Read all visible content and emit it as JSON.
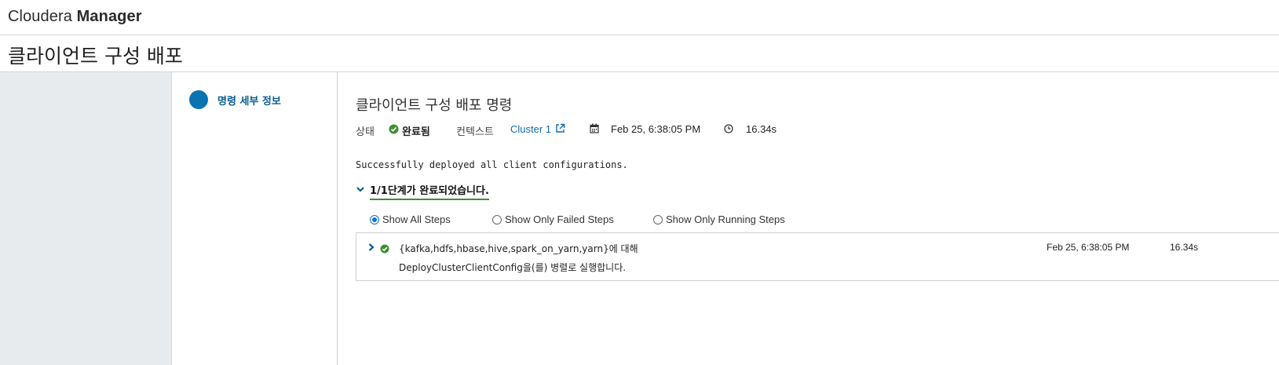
{
  "header": {
    "brand_light": "Cloudera",
    "brand_bold": "Manager"
  },
  "page": {
    "title": "클라이언트 구성 배포"
  },
  "sidebar": {
    "step_label": "명령 세부 정보"
  },
  "command": {
    "title": "클라이언트 구성 배포 명령",
    "status_label": "상태",
    "status_value": "완료됨",
    "context_label": "컨텍스트",
    "context_link": "Cluster 1",
    "start_time": "Feb 25, 6:38:05 PM",
    "duration": "16.34s",
    "message": "Successfully deployed all client configurations.",
    "summary": "1/1단계가 완료되었습니다."
  },
  "filters": {
    "options": [
      "Show All Steps",
      "Show Only Failed Steps",
      "Show Only Running Steps"
    ],
    "selected": "Show All Steps"
  },
  "steps": [
    {
      "line1": "{kafka,hdfs,hbase,hive,spark_on_yarn,yarn}에 대해",
      "line2": "DeployClusterClientConfig을(를) 병렬로 실행합니다.",
      "time": "Feb 25, 6:38:05 PM",
      "duration": "16.34s",
      "status": "success"
    }
  ],
  "colors": {
    "accent": "#0a74b3",
    "success": "#3f8f2d",
    "link": "#0a6eb0"
  },
  "icons": [
    "check-circle-icon",
    "external-link-icon",
    "calendar-icon",
    "clock-icon",
    "chevron-down-icon",
    "chevron-right-icon"
  ]
}
